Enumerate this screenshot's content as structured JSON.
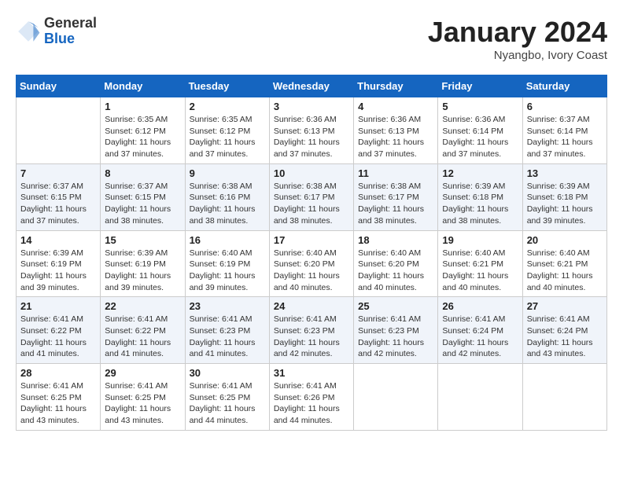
{
  "header": {
    "logo_general": "General",
    "logo_blue": "Blue",
    "month_year": "January 2024",
    "location": "Nyangbo, Ivory Coast"
  },
  "weekdays": [
    "Sunday",
    "Monday",
    "Tuesday",
    "Wednesday",
    "Thursday",
    "Friday",
    "Saturday"
  ],
  "weeks": [
    [
      {
        "day": "",
        "info": ""
      },
      {
        "day": "1",
        "info": "Sunrise: 6:35 AM\nSunset: 6:12 PM\nDaylight: 11 hours\nand 37 minutes."
      },
      {
        "day": "2",
        "info": "Sunrise: 6:35 AM\nSunset: 6:12 PM\nDaylight: 11 hours\nand 37 minutes."
      },
      {
        "day": "3",
        "info": "Sunrise: 6:36 AM\nSunset: 6:13 PM\nDaylight: 11 hours\nand 37 minutes."
      },
      {
        "day": "4",
        "info": "Sunrise: 6:36 AM\nSunset: 6:13 PM\nDaylight: 11 hours\nand 37 minutes."
      },
      {
        "day": "5",
        "info": "Sunrise: 6:36 AM\nSunset: 6:14 PM\nDaylight: 11 hours\nand 37 minutes."
      },
      {
        "day": "6",
        "info": "Sunrise: 6:37 AM\nSunset: 6:14 PM\nDaylight: 11 hours\nand 37 minutes."
      }
    ],
    [
      {
        "day": "7",
        "info": "Sunrise: 6:37 AM\nSunset: 6:15 PM\nDaylight: 11 hours\nand 37 minutes."
      },
      {
        "day": "8",
        "info": "Sunrise: 6:37 AM\nSunset: 6:15 PM\nDaylight: 11 hours\nand 38 minutes."
      },
      {
        "day": "9",
        "info": "Sunrise: 6:38 AM\nSunset: 6:16 PM\nDaylight: 11 hours\nand 38 minutes."
      },
      {
        "day": "10",
        "info": "Sunrise: 6:38 AM\nSunset: 6:17 PM\nDaylight: 11 hours\nand 38 minutes."
      },
      {
        "day": "11",
        "info": "Sunrise: 6:38 AM\nSunset: 6:17 PM\nDaylight: 11 hours\nand 38 minutes."
      },
      {
        "day": "12",
        "info": "Sunrise: 6:39 AM\nSunset: 6:18 PM\nDaylight: 11 hours\nand 38 minutes."
      },
      {
        "day": "13",
        "info": "Sunrise: 6:39 AM\nSunset: 6:18 PM\nDaylight: 11 hours\nand 39 minutes."
      }
    ],
    [
      {
        "day": "14",
        "info": "Sunrise: 6:39 AM\nSunset: 6:19 PM\nDaylight: 11 hours\nand 39 minutes."
      },
      {
        "day": "15",
        "info": "Sunrise: 6:39 AM\nSunset: 6:19 PM\nDaylight: 11 hours\nand 39 minutes."
      },
      {
        "day": "16",
        "info": "Sunrise: 6:40 AM\nSunset: 6:19 PM\nDaylight: 11 hours\nand 39 minutes."
      },
      {
        "day": "17",
        "info": "Sunrise: 6:40 AM\nSunset: 6:20 PM\nDaylight: 11 hours\nand 40 minutes."
      },
      {
        "day": "18",
        "info": "Sunrise: 6:40 AM\nSunset: 6:20 PM\nDaylight: 11 hours\nand 40 minutes."
      },
      {
        "day": "19",
        "info": "Sunrise: 6:40 AM\nSunset: 6:21 PM\nDaylight: 11 hours\nand 40 minutes."
      },
      {
        "day": "20",
        "info": "Sunrise: 6:40 AM\nSunset: 6:21 PM\nDaylight: 11 hours\nand 40 minutes."
      }
    ],
    [
      {
        "day": "21",
        "info": "Sunrise: 6:41 AM\nSunset: 6:22 PM\nDaylight: 11 hours\nand 41 minutes."
      },
      {
        "day": "22",
        "info": "Sunrise: 6:41 AM\nSunset: 6:22 PM\nDaylight: 11 hours\nand 41 minutes."
      },
      {
        "day": "23",
        "info": "Sunrise: 6:41 AM\nSunset: 6:23 PM\nDaylight: 11 hours\nand 41 minutes."
      },
      {
        "day": "24",
        "info": "Sunrise: 6:41 AM\nSunset: 6:23 PM\nDaylight: 11 hours\nand 42 minutes."
      },
      {
        "day": "25",
        "info": "Sunrise: 6:41 AM\nSunset: 6:23 PM\nDaylight: 11 hours\nand 42 minutes."
      },
      {
        "day": "26",
        "info": "Sunrise: 6:41 AM\nSunset: 6:24 PM\nDaylight: 11 hours\nand 42 minutes."
      },
      {
        "day": "27",
        "info": "Sunrise: 6:41 AM\nSunset: 6:24 PM\nDaylight: 11 hours\nand 43 minutes."
      }
    ],
    [
      {
        "day": "28",
        "info": "Sunrise: 6:41 AM\nSunset: 6:25 PM\nDaylight: 11 hours\nand 43 minutes."
      },
      {
        "day": "29",
        "info": "Sunrise: 6:41 AM\nSunset: 6:25 PM\nDaylight: 11 hours\nand 43 minutes."
      },
      {
        "day": "30",
        "info": "Sunrise: 6:41 AM\nSunset: 6:25 PM\nDaylight: 11 hours\nand 44 minutes."
      },
      {
        "day": "31",
        "info": "Sunrise: 6:41 AM\nSunset: 6:26 PM\nDaylight: 11 hours\nand 44 minutes."
      },
      {
        "day": "",
        "info": ""
      },
      {
        "day": "",
        "info": ""
      },
      {
        "day": "",
        "info": ""
      }
    ]
  ]
}
